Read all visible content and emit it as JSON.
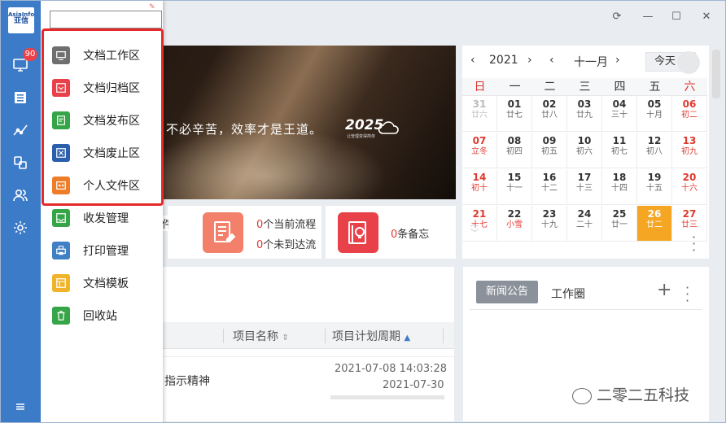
{
  "logo": {
    "en": "AsiaInfo",
    "cn": "亚信"
  },
  "rail": {
    "badge": "90",
    "icons": [
      "monitor-icon",
      "document-list-icon",
      "trend-icon",
      "swap-icon",
      "users-icon",
      "gear-icon",
      "hamburger-icon"
    ]
  },
  "titlebar": {
    "refresh": "⟳",
    "minimize": "—",
    "maximize": "☐",
    "close": "✕"
  },
  "search": {
    "value": "",
    "placeholder": ""
  },
  "menu": {
    "items": [
      {
        "label": "文档工作区",
        "icon": "monitor-icon",
        "color": "#6f6f6f"
      },
      {
        "label": "文档归档区",
        "icon": "archive-icon",
        "color": "#e9414a"
      },
      {
        "label": "文档发布区",
        "icon": "publish-icon",
        "color": "#35a548"
      },
      {
        "label": "文档废止区",
        "icon": "void-icon",
        "color": "#2b5fad"
      },
      {
        "label": "个人文件区",
        "icon": "personal-file-icon",
        "color": "#ee7d2a"
      },
      {
        "label": "收发管理",
        "icon": "inbox-icon",
        "color": "#35a548"
      },
      {
        "label": "打印管理",
        "icon": "printer-icon",
        "color": "#3f7fc4"
      },
      {
        "label": "文档模板",
        "icon": "template-icon",
        "color": "#f0b429"
      },
      {
        "label": "回收站",
        "icon": "recycle-icon",
        "color": "#35a548"
      }
    ]
  },
  "banner": {
    "slogan": "不必辛苦，效率才是王道。",
    "brand": "2025",
    "brand_sub": "让管理变得简单"
  },
  "calendar": {
    "year": "2021",
    "month": "十一月",
    "today": "今天",
    "weekdays": [
      "日",
      "一",
      "二",
      "三",
      "四",
      "五",
      "六"
    ],
    "weeks": [
      [
        [
          "31",
          "廿六",
          "dim"
        ],
        [
          "01",
          "廿七",
          ""
        ],
        [
          "02",
          "廿八",
          ""
        ],
        [
          "03",
          "廿九",
          ""
        ],
        [
          "04",
          "三十",
          ""
        ],
        [
          "05",
          "十月",
          ""
        ],
        [
          "06",
          "初二",
          "red"
        ]
      ],
      [
        [
          "07",
          "立冬",
          "red"
        ],
        [
          "08",
          "初四",
          ""
        ],
        [
          "09",
          "初五",
          ""
        ],
        [
          "10",
          "初六",
          ""
        ],
        [
          "11",
          "初七",
          ""
        ],
        [
          "12",
          "初八",
          ""
        ],
        [
          "13",
          "初九",
          "red"
        ]
      ],
      [
        [
          "14",
          "初十",
          "red"
        ],
        [
          "15",
          "十一",
          ""
        ],
        [
          "16",
          "十二",
          ""
        ],
        [
          "17",
          "十三",
          ""
        ],
        [
          "18",
          "十四",
          ""
        ],
        [
          "19",
          "十五",
          ""
        ],
        [
          "20",
          "十六",
          "red"
        ]
      ],
      [
        [
          "21",
          "十七",
          "red"
        ],
        [
          "22",
          "小雪",
          "redl"
        ],
        [
          "23",
          "十九",
          ""
        ],
        [
          "24",
          "二十",
          ""
        ],
        [
          "25",
          "廿一",
          ""
        ],
        [
          "26",
          "廿二",
          "sel"
        ],
        [
          "27",
          "廿三",
          "red"
        ]
      ]
    ]
  },
  "stats": {
    "partial_text": "件未读",
    "flow_current_num": "0",
    "flow_current_label": "个当前流程",
    "flow_pending_num": "0",
    "flow_pending_label": "个未到达流",
    "memo_num": "0",
    "memo_label": "条备忘"
  },
  "projects": {
    "columns": [
      "项目名称",
      "项目计划周期"
    ],
    "row": {
      "name": "指示精神",
      "start": "2021-07-08 14:03:28",
      "end": "2021-07-30"
    }
  },
  "news": {
    "tab_active": "新闻公告",
    "tab": "工作圈",
    "add": "+"
  },
  "watermark": "二零二五科技",
  "colors": {
    "rail": "#3c7bc8",
    "highlight": "#e52a2a",
    "selected_day": "#f5a623"
  }
}
